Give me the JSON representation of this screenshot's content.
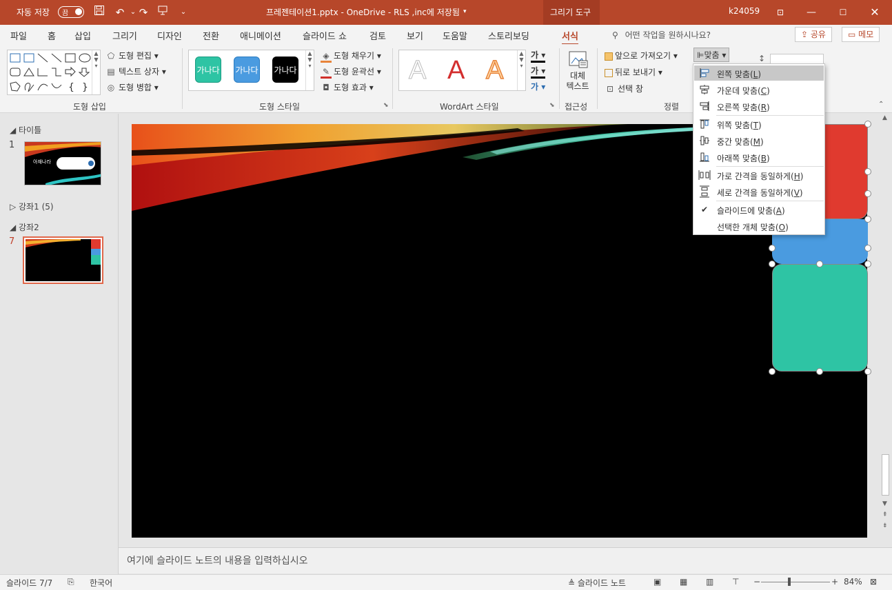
{
  "titlebar": {
    "autosave_label": "자동 저장",
    "autosave_state": "끔",
    "doc_title": "프레젠테이션1.pptx  -  OneDrive - RLS ,inc에 저장됨",
    "contextual_tab": "그리기 도구",
    "user": "k24059"
  },
  "tabs": [
    "파일",
    "홈",
    "삽입",
    "그리기",
    "디자인",
    "전환",
    "애니메이션",
    "슬라이드 쇼",
    "검토",
    "보기",
    "도움말",
    "스토리보딩",
    "서식"
  ],
  "tellme_placeholder": "어떤 작업을 원하시나요?",
  "share_label": "공유",
  "comment_label": "메모",
  "ribbon": {
    "insert_shapes": {
      "edit_shape": "도형 편집",
      "text_box": "텍스트 상자",
      "merge_shapes": "도형 병합",
      "label": "도형 삽입"
    },
    "shape_styles": {
      "chips": [
        {
          "text": "가나다",
          "color": "#2ec4a4"
        },
        {
          "text": "가나다",
          "color": "#4a9be0"
        },
        {
          "text": "가나다",
          "color": "#000000"
        }
      ],
      "fill": "도형 채우기",
      "outline": "도형 윤곽선",
      "effects": "도형 효과",
      "label": "도형 스타일"
    },
    "wordart": {
      "letters": [
        "A",
        "A",
        "A"
      ],
      "label": "WordArt 스타일",
      "text_glyphs": [
        "가",
        "가",
        "가"
      ]
    },
    "accessibility": {
      "alt_text_line1": "대체",
      "alt_text_line2": "텍스트",
      "label": "접근성"
    },
    "arrange": {
      "bring_forward": "앞으로 가져오기",
      "send_backward": "뒤로 보내기",
      "selection_pane": "선택 창",
      "align": "맞춤",
      "label": "정렬"
    }
  },
  "left_panel": {
    "sections": [
      {
        "title": "타이틀"
      },
      {
        "title": "강좌1 (5)"
      },
      {
        "title": "강좌2"
      }
    ],
    "slides": [
      {
        "number": "1",
        "thumb_text": "아재나라"
      },
      {
        "number": "7"
      }
    ]
  },
  "align_menu": {
    "items": [
      {
        "label": "왼쪽 맞춤",
        "key": "L",
        "icon": "align-left-icon"
      },
      {
        "label": "가운데 맞춤",
        "key": "C",
        "icon": "align-center-icon"
      },
      {
        "label": "오른쪽 맞춤",
        "key": "R",
        "icon": "align-right-icon"
      },
      {
        "label": "위쪽 맞춤",
        "key": "T",
        "icon": "align-top-icon"
      },
      {
        "label": "중간 맞춤",
        "key": "M",
        "icon": "align-middle-icon"
      },
      {
        "label": "아래쪽 맞춤",
        "key": "B",
        "icon": "align-bottom-icon"
      },
      {
        "label": "가로 간격을 동일하게",
        "key": "H",
        "icon": "distribute-horizontal-icon"
      },
      {
        "label": "세로 간격을 동일하게",
        "key": "V",
        "icon": "distribute-vertical-icon"
      },
      {
        "label": "슬라이드에 맞춤",
        "key": "A",
        "icon": "checkmark-icon"
      },
      {
        "label": "선택한 개체 맞춤",
        "key": "O",
        "icon": ""
      }
    ]
  },
  "notes_placeholder": "여기에 슬라이드 노트의 내용을 입력하십시오",
  "statusbar": {
    "slide_info": "슬라이드 7/7",
    "language": "한국어",
    "notes_label": "슬라이드 노트",
    "zoom": "84%"
  },
  "colors": {
    "accent": "#b7472a",
    "red_block": "#e03a2f",
    "blue_block": "#4a9be0",
    "green_block": "#2ec4a4"
  }
}
